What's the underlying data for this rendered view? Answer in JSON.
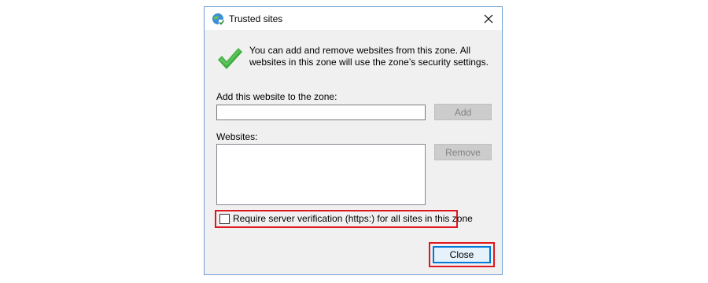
{
  "window": {
    "title": "Trusted sites",
    "title_icon": "globe-check-icon",
    "close_icon": "close-icon"
  },
  "info": {
    "icon": "green-checkmark-icon",
    "text": "You can add and remove websites from this zone. All websites in this zone will use the zone’s security settings."
  },
  "add_section": {
    "label": "Add this website to the zone:",
    "input_value": "",
    "add_button": "Add"
  },
  "websites_section": {
    "label": "Websites:",
    "items": [],
    "remove_button": "Remove"
  },
  "https_checkbox": {
    "label": "Require server verification (https:) for all sites in this zone",
    "checked": false
  },
  "footer": {
    "close_button": "Close"
  },
  "colors": {
    "highlight": "#e0161d",
    "dialog_bg": "#f0f0f0",
    "focus_border": "#0078d7",
    "check_green": "#3fae3f"
  }
}
